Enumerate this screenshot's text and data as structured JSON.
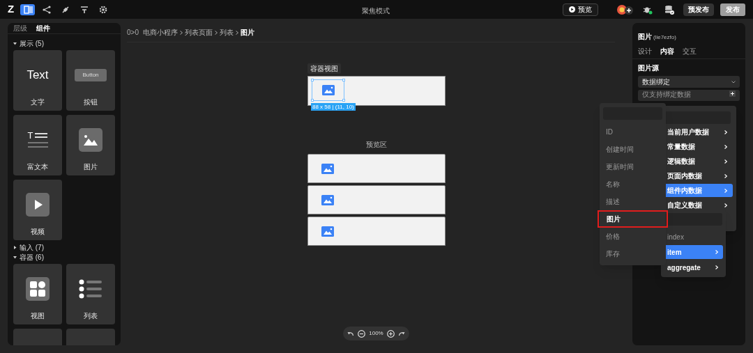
{
  "topbar": {
    "logo": "Z",
    "tools": [
      {
        "kind": "page",
        "selected": true
      },
      {
        "kind": "tree",
        "selected": false
      },
      {
        "kind": "plug",
        "selected": false
      },
      {
        "kind": "filter",
        "selected": false
      },
      {
        "kind": "gear",
        "selected": false
      }
    ],
    "mode": "聚焦模式",
    "preview": "预览",
    "prerelease": "预发布",
    "publish": "发布"
  },
  "left_panel": {
    "tabs": [
      {
        "label": "层级",
        "selected": false
      },
      {
        "label": "组件",
        "selected": true
      }
    ],
    "groups": [
      {
        "label": "展示 (5)",
        "expanded": true,
        "items": [
          {
            "kind": "text",
            "label": "文字",
            "glyph": "Text"
          },
          {
            "kind": "button",
            "label": "按钮",
            "glyph": "Button"
          },
          {
            "kind": "richtext",
            "label": "富文本",
            "glyph": "T"
          },
          {
            "kind": "image",
            "label": "图片"
          },
          {
            "kind": "video",
            "label": "视频"
          }
        ]
      },
      {
        "label": "输入 (7)",
        "expanded": false
      },
      {
        "label": "容器 (6)",
        "expanded": true,
        "items": [
          {
            "kind": "view",
            "label": "视图"
          },
          {
            "kind": "list",
            "label": "列表"
          },
          {
            "kind": "blank"
          },
          {
            "kind": "blank"
          }
        ]
      }
    ]
  },
  "breadcrumb": {
    "prefix": "0>0",
    "path": [
      "电商小程序",
      "列表页面",
      "列表",
      "图片"
    ]
  },
  "canvas": {
    "container_label": "容器视图",
    "size_label": "88 x 58 | (11, 10)",
    "preview_label": "预览区"
  },
  "zoom": {
    "value": "100%"
  },
  "right_panel": {
    "title": "图片",
    "id": "(lie7ezfo)",
    "tabs": [
      {
        "label": "设计",
        "selected": false
      },
      {
        "label": "内容",
        "selected": true
      },
      {
        "label": "交互",
        "selected": false
      }
    ],
    "section": "图片源",
    "source": "数据绑定",
    "binding": "仅支持绑定数据"
  },
  "menus": [
    {
      "items": [
        {
          "label": "当前用户数据",
          "selected": false
        },
        {
          "label": "常量数据",
          "selected": false
        },
        {
          "label": "逻辑数据",
          "selected": false
        },
        {
          "label": "页面内数据",
          "selected": false
        },
        {
          "label": "组件内数据",
          "selected": true
        },
        {
          "label": "自定义数据",
          "selected": false
        }
      ]
    },
    {
      "items": [
        {
          "label": "index",
          "disabled": true,
          "submenu": false,
          "selected": false
        },
        {
          "label": "item",
          "disabled": false,
          "submenu": true,
          "selected": true
        },
        {
          "label": "aggregate",
          "disabled": false,
          "submenu": true,
          "selected": false
        }
      ]
    },
    {
      "items": [
        {
          "label": "ID",
          "boxed": false
        },
        {
          "label": "创建时间",
          "boxed": false
        },
        {
          "label": "更新时间",
          "boxed": false
        },
        {
          "label": "名称",
          "boxed": false
        },
        {
          "label": "描述",
          "boxed": false
        },
        {
          "label": "图片",
          "boxed": true
        },
        {
          "label": "价格",
          "boxed": false
        },
        {
          "label": "库存",
          "boxed": false
        }
      ]
    }
  ]
}
